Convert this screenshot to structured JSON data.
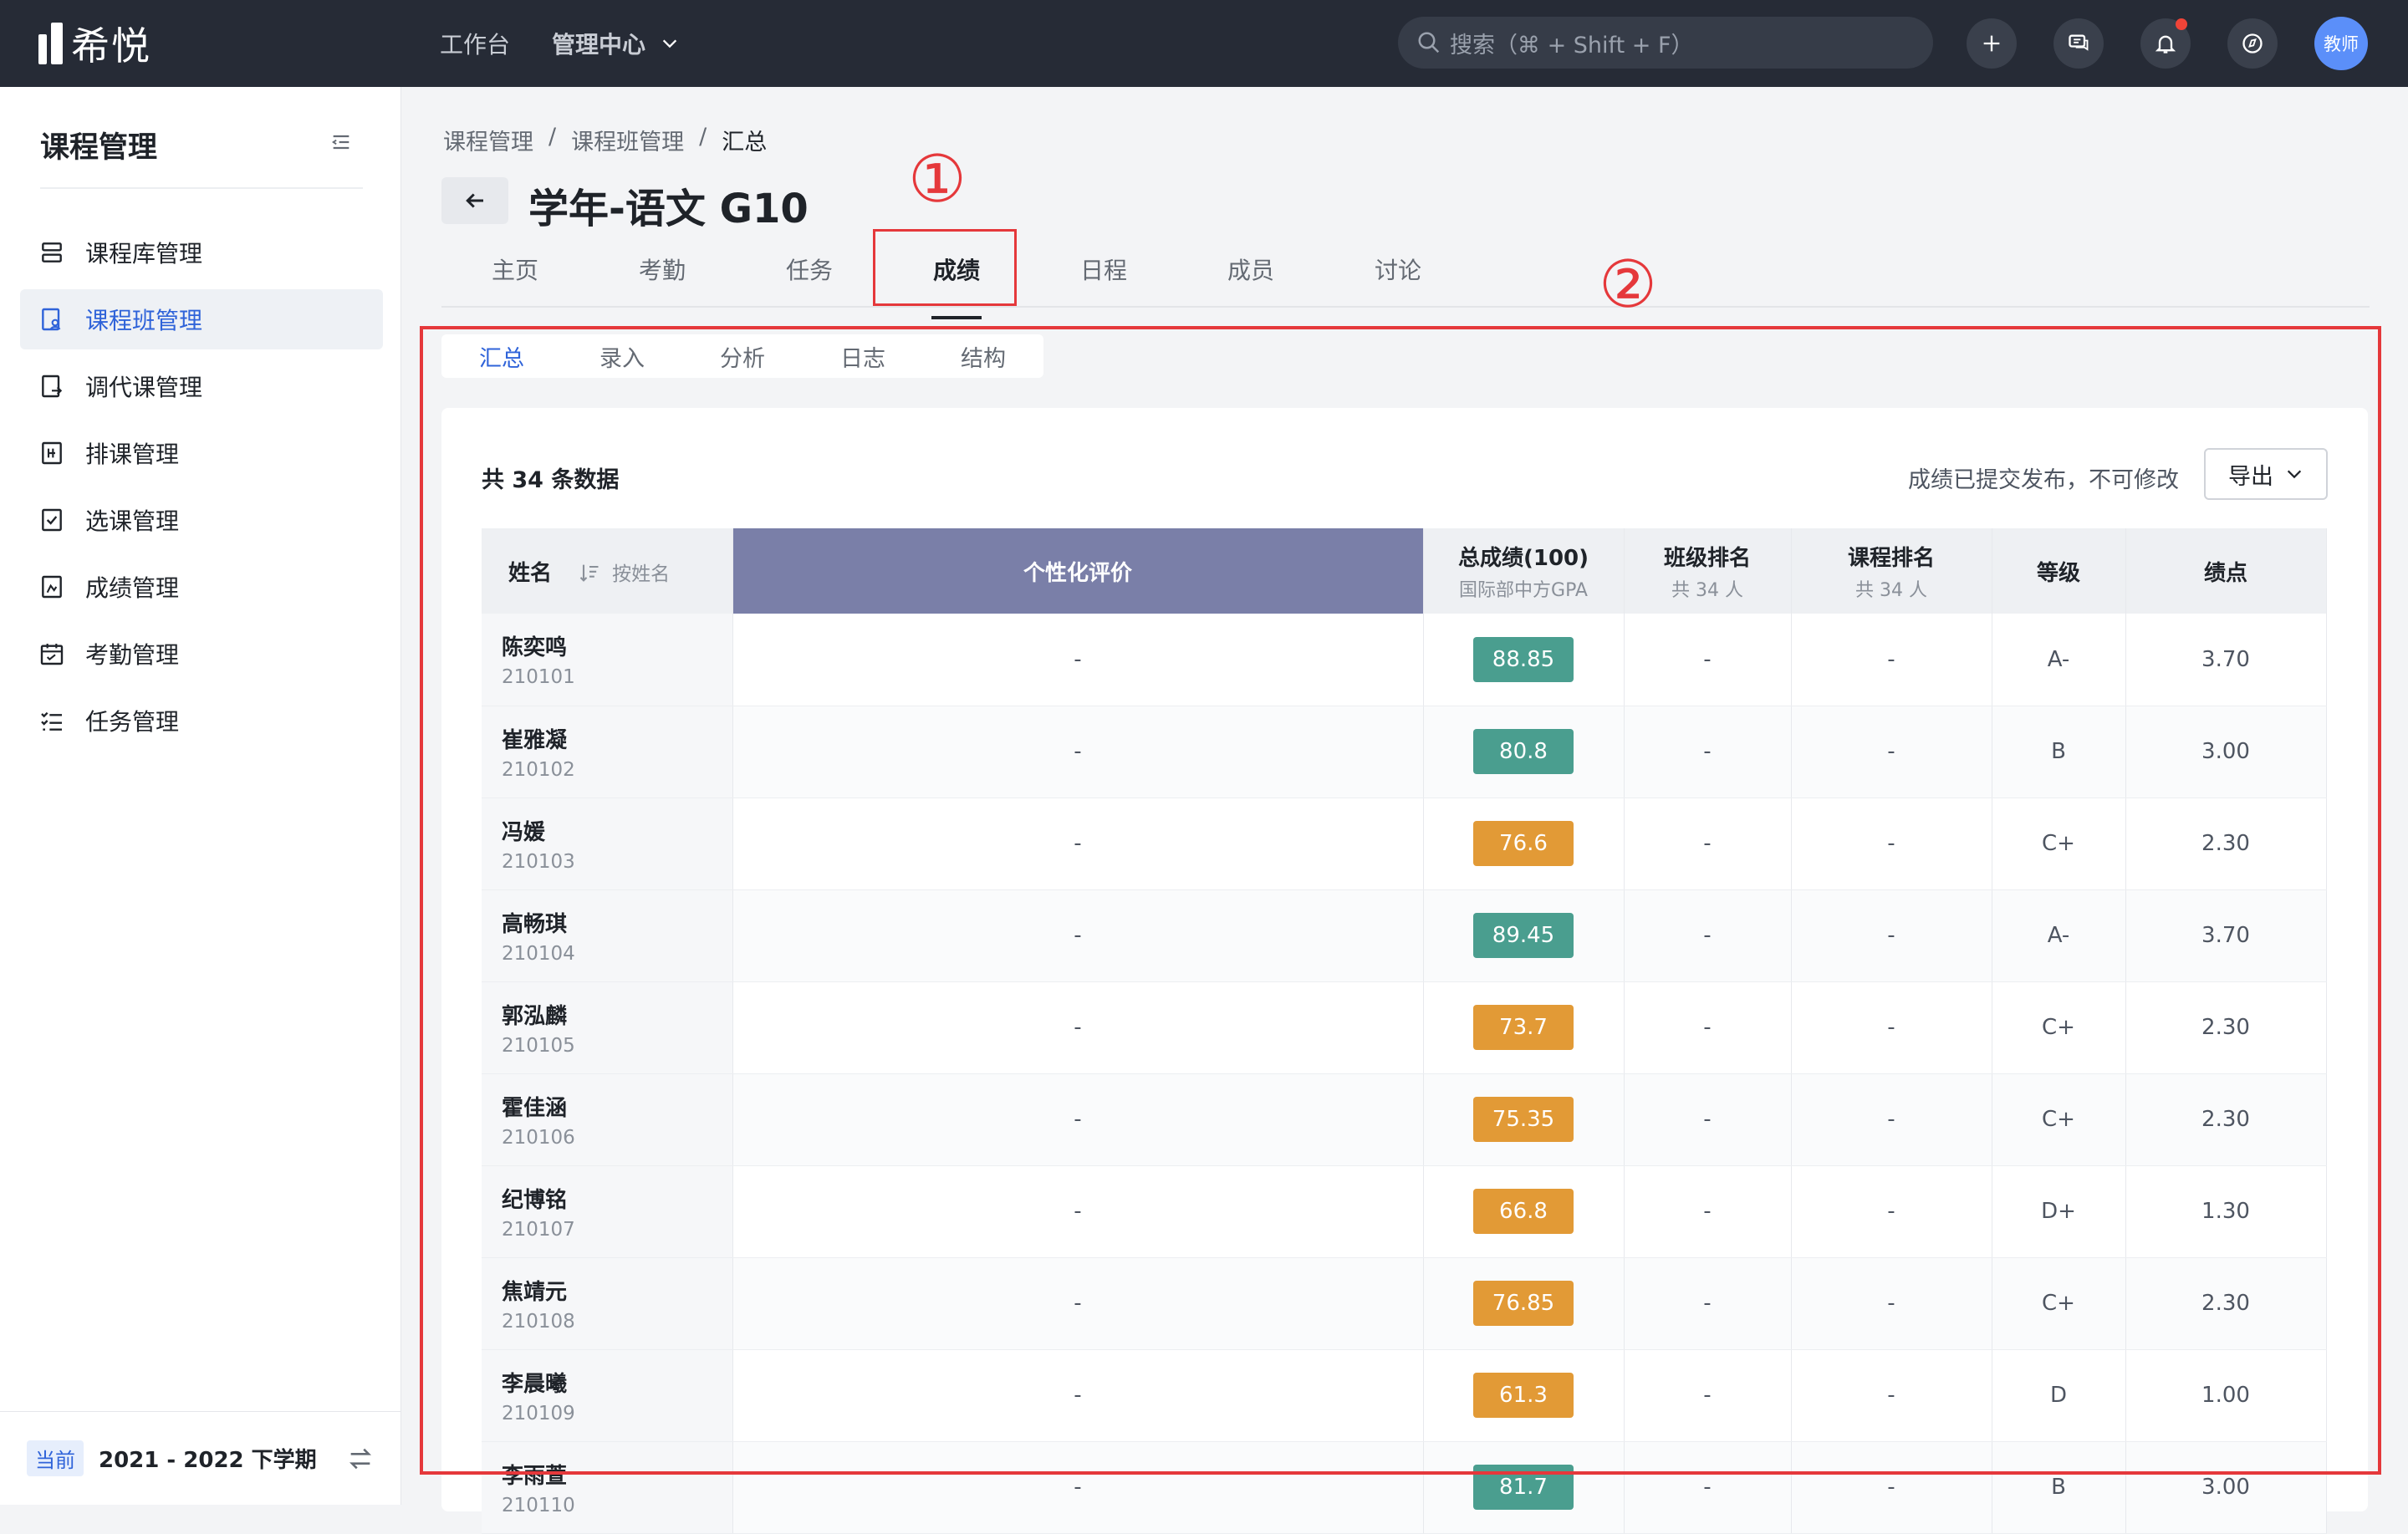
{
  "app": {
    "name": "希悦"
  },
  "topnav": {
    "workbench": "工作台",
    "admin": "管理中心"
  },
  "search": {
    "placeholder": "搜索（⌘ + Shift + F）"
  },
  "user": {
    "avatar_label": "教师"
  },
  "sidebar": {
    "title": "课程管理",
    "items": [
      {
        "label": "课程库管理",
        "icon": "stack-icon"
      },
      {
        "label": "课程班管理",
        "icon": "class-icon",
        "active": true
      },
      {
        "label": "调代课管理",
        "icon": "swap-doc-icon"
      },
      {
        "label": "排课管理",
        "icon": "schedule-icon"
      },
      {
        "label": "选课管理",
        "icon": "checkbox-icon"
      },
      {
        "label": "成绩管理",
        "icon": "grade-icon"
      },
      {
        "label": "考勤管理",
        "icon": "calendar-icon"
      },
      {
        "label": "任务管理",
        "icon": "tasklist-icon"
      }
    ],
    "term_tag": "当前",
    "term": "2021 - 2022 下学期"
  },
  "breadcrumb": [
    "课程管理",
    "课程班管理",
    "汇总"
  ],
  "page_title": "学年-语文 G10",
  "tabs": [
    "主页",
    "考勤",
    "任务",
    "成绩",
    "日程",
    "成员",
    "讨论"
  ],
  "active_tab": "成绩",
  "annotations": {
    "one": "①",
    "two": "②"
  },
  "subtabs": [
    "汇总",
    "录入",
    "分析",
    "日志",
    "结构"
  ],
  "summary": {
    "count": "共 34 条数据",
    "lock_note": "成绩已提交发布，不可修改",
    "export": "导出"
  },
  "table": {
    "headers": {
      "name": "姓名",
      "sort": "按姓名",
      "eval": "个性化评价",
      "total": "总成绩(100)",
      "total_sub": "国际部中方GPA",
      "class_rank": "班级排名",
      "class_rank_sub": "共 34 人",
      "course_rank": "课程排名",
      "course_rank_sub": "共 34 人",
      "level": "等级",
      "gpa": "绩点"
    },
    "rows": [
      {
        "name": "陈奕鸣",
        "id": "210101",
        "eval": "-",
        "score": "88.85",
        "color": "#4a9e8f",
        "class_rank": "-",
        "course_rank": "-",
        "level": "A-",
        "gpa": "3.70"
      },
      {
        "name": "崔雅凝",
        "id": "210102",
        "eval": "-",
        "score": "80.8",
        "color": "#4a9e8f",
        "class_rank": "-",
        "course_rank": "-",
        "level": "B",
        "gpa": "3.00"
      },
      {
        "name": "冯媛",
        "id": "210103",
        "eval": "-",
        "score": "76.6",
        "color": "#e29a36",
        "class_rank": "-",
        "course_rank": "-",
        "level": "C+",
        "gpa": "2.30"
      },
      {
        "name": "高畅琪",
        "id": "210104",
        "eval": "-",
        "score": "89.45",
        "color": "#4a9e8f",
        "class_rank": "-",
        "course_rank": "-",
        "level": "A-",
        "gpa": "3.70"
      },
      {
        "name": "郭泓麟",
        "id": "210105",
        "eval": "-",
        "score": "73.7",
        "color": "#e29a36",
        "class_rank": "-",
        "course_rank": "-",
        "level": "C+",
        "gpa": "2.30"
      },
      {
        "name": "霍佳涵",
        "id": "210106",
        "eval": "-",
        "score": "75.35",
        "color": "#e29a36",
        "class_rank": "-",
        "course_rank": "-",
        "level": "C+",
        "gpa": "2.30"
      },
      {
        "name": "纪博铭",
        "id": "210107",
        "eval": "-",
        "score": "66.8",
        "color": "#e29a36",
        "class_rank": "-",
        "course_rank": "-",
        "level": "D+",
        "gpa": "1.30"
      },
      {
        "name": "焦靖元",
        "id": "210108",
        "eval": "-",
        "score": "76.85",
        "color": "#e29a36",
        "class_rank": "-",
        "course_rank": "-",
        "level": "C+",
        "gpa": "2.30"
      },
      {
        "name": "李晨曦",
        "id": "210109",
        "eval": "-",
        "score": "61.3",
        "color": "#e29a36",
        "class_rank": "-",
        "course_rank": "-",
        "level": "D",
        "gpa": "1.00"
      },
      {
        "name": "李雨萱",
        "id": "210110",
        "eval": "-",
        "score": "81.7",
        "color": "#4a9e8f",
        "class_rank": "-",
        "course_rank": "-",
        "level": "B",
        "gpa": "3.00"
      }
    ]
  }
}
